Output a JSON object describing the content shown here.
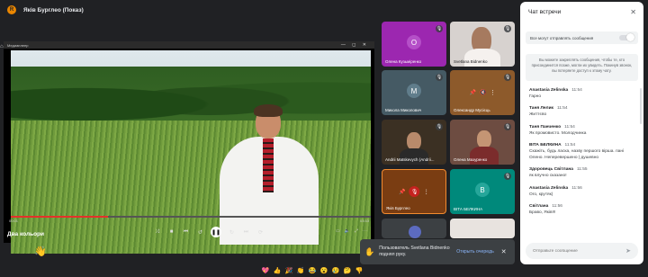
{
  "header": {
    "rec_badge": "R",
    "title": "Якiв Бурглео (Показ)"
  },
  "player": {
    "window_title": "Медиаплеер",
    "window_controls": "— ◻ ✕",
    "current_time": "00:01",
    "total_time": "03:53",
    "progress": 0.27,
    "label": "Два кольори"
  },
  "tiles": [
    {
      "name": "Олена Кузьмiренко",
      "avatar": "О",
      "color": "#9c27b0"
    },
    {
      "name": "Svetlana Bidnenko",
      "color": "#d7d2cf"
    },
    {
      "name": "Микола Миколович",
      "avatar": "М",
      "color": "#455a64"
    },
    {
      "name": "Олександр Мусiєць",
      "color": "#8d5a2b"
    },
    {
      "name": "Andrii Matskevych (Andrii...",
      "color": "#3b3023"
    },
    {
      "name": "Олена Мазуренко",
      "color": "#6d4c41"
    },
    {
      "name": "Якiв Бурглео",
      "color": "#7a3d12"
    },
    {
      "name": "ВIТА БЕЛКИНА",
      "avatar": "В",
      "color": "#00897b"
    }
  ],
  "toast": {
    "text": "Пользователь Svetlana Bidnenko поднял руку.",
    "action": "Открыть очередь"
  },
  "reactions": [
    "💖",
    "👍",
    "🎉",
    "👏",
    "😂",
    "😮",
    "😢",
    "🤔",
    "👎"
  ],
  "chat": {
    "title": "Чат встречи",
    "permission_label": "Все могут отправлять сообщения",
    "info": "Вы можете закреплять сообщения, чтобы те, кто присоединится позже, могли их увидеть. Покинув звонок, вы потеряете доступ к этому чату.",
    "messages": [
      {
        "author": "Anastasia Zelinska",
        "time": "11:54",
        "text": "Гарно"
      },
      {
        "author": "Таня Лелик",
        "time": "11:54",
        "text": "Життєво"
      },
      {
        "author": "Таня Панченко",
        "time": "11:54",
        "text": "Як промовисто. Молодчинка"
      },
      {
        "author": "ВIТА БЕЛКИНА",
        "time": "11:54",
        "text": "Скажiть, будь ласка, назву першого вiрша. пані Олено. Неперевершено | душевно"
      },
      {
        "author": "Здоровець Свiтлана",
        "time": "11:55",
        "text": "як влучно сказано!"
      },
      {
        "author": "Anastasia Zelinska",
        "time": "11:56",
        "text": "Ого, крутяк)"
      },
      {
        "author": "Свiтлана",
        "time": "11:56",
        "text": "Браво, Якiв!!!"
      }
    ],
    "input_placeholder": "Отправьте сообщение"
  }
}
